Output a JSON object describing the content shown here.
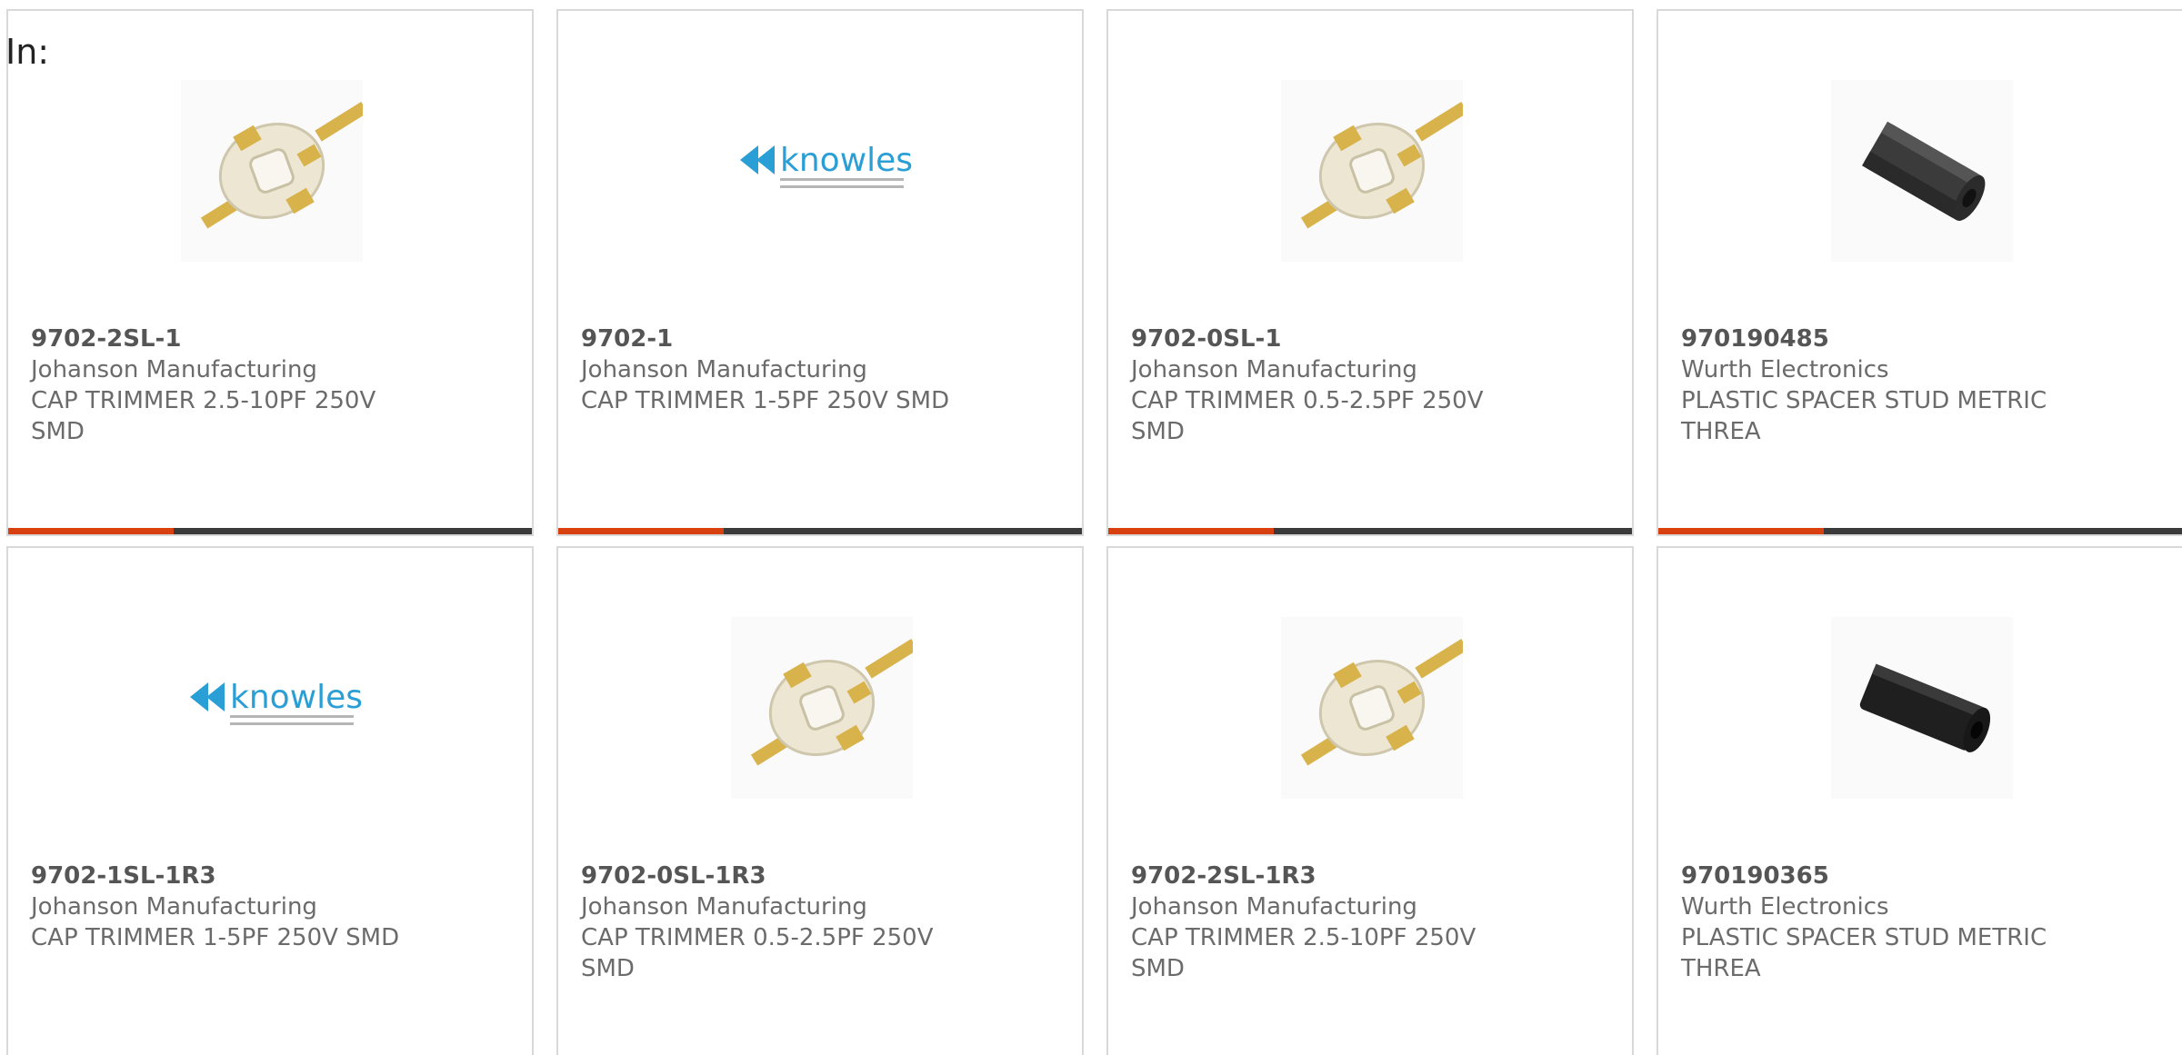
{
  "header": {
    "in_label": "In:"
  },
  "theme": {
    "accent_color": "#d9400f",
    "bar_color": "#3a3a3a"
  },
  "products": [
    {
      "part_number": "9702-2SL-1",
      "manufacturer": "Johanson Manufacturing",
      "desc_line1": "CAP TRIMMER 2.5-10PF 250V",
      "desc_line2": "SMD",
      "image": "trimmer-capacitor-image"
    },
    {
      "part_number": "9702-1",
      "manufacturer": "Johanson Manufacturing",
      "desc_line1": "CAP TRIMMER 1-5PF 250V SMD",
      "desc_line2": "",
      "image": "knowles-logo-image"
    },
    {
      "part_number": "9702-0SL-1",
      "manufacturer": "Johanson Manufacturing",
      "desc_line1": "CAP TRIMMER 0.5-2.5PF 250V",
      "desc_line2": "SMD",
      "image": "trimmer-capacitor-image"
    },
    {
      "part_number": "970190485",
      "manufacturer": "Wurth Electronics",
      "desc_line1": "PLASTIC SPACER STUD METRIC",
      "desc_line2": "THREA",
      "image": "spacer-stud-image"
    },
    {
      "part_number": "9702-1SL-1R3",
      "manufacturer": "Johanson Manufacturing",
      "desc_line1": "CAP TRIMMER 1-5PF 250V SMD",
      "desc_line2": "",
      "image": "knowles-logo-image"
    },
    {
      "part_number": "9702-0SL-1R3",
      "manufacturer": "Johanson Manufacturing",
      "desc_line1": "CAP TRIMMER 0.5-2.5PF 250V",
      "desc_line2": "SMD",
      "image": "trimmer-capacitor-image"
    },
    {
      "part_number": "9702-2SL-1R3",
      "manufacturer": "Johanson Manufacturing",
      "desc_line1": "CAP TRIMMER 2.5-10PF 250V",
      "desc_line2": "SMD",
      "image": "trimmer-capacitor-image"
    },
    {
      "part_number": "970190365",
      "manufacturer": "Wurth Electronics",
      "desc_line1": "PLASTIC SPACER STUD METRIC",
      "desc_line2": "THREA",
      "image": "spacer-stud-image"
    }
  ]
}
